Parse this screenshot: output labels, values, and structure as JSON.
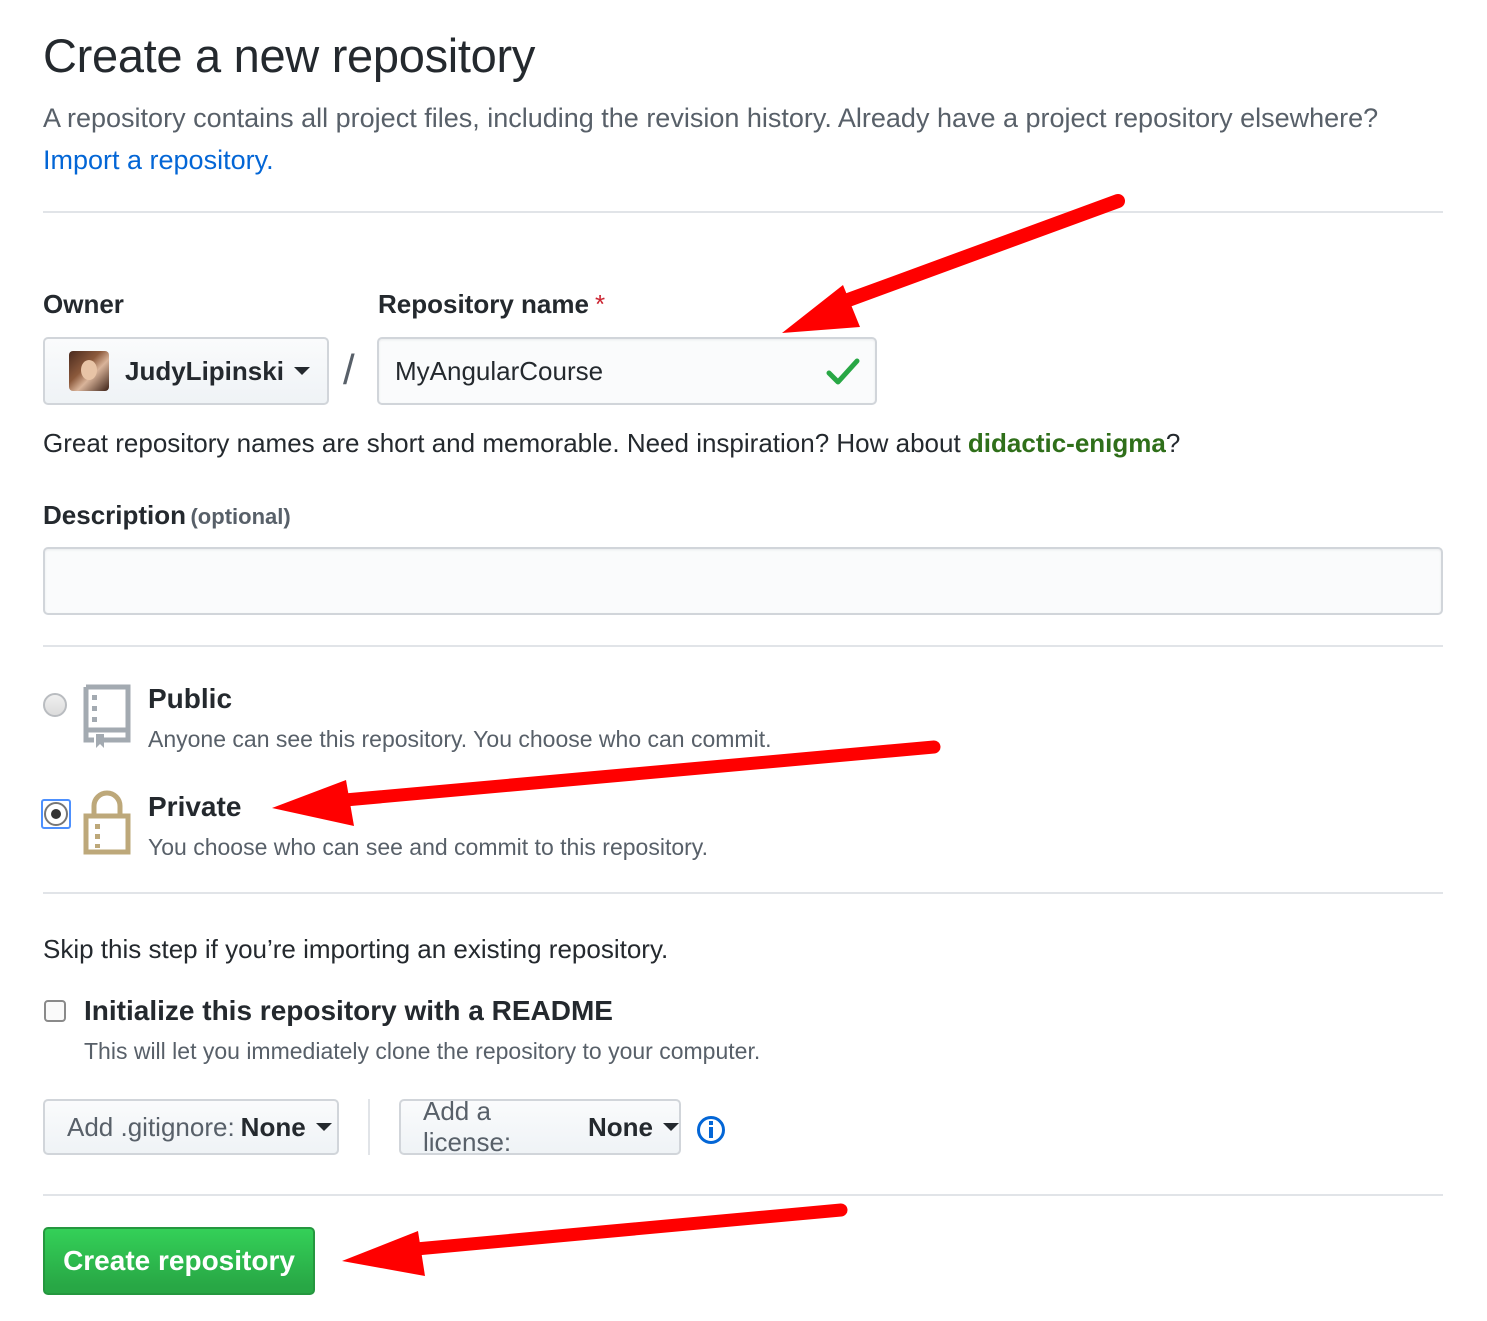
{
  "header": {
    "title": "Create a new repository",
    "subtitle": "A repository contains all project files, including the revision history. Already have a project repository elsewhere?",
    "import_link": "Import a repository."
  },
  "owner": {
    "label": "Owner",
    "value": "JudyLipinski",
    "separator": "/"
  },
  "repo_name": {
    "label": "Repository name",
    "required_mark": "*",
    "value": "MyAngularCourse",
    "valid": true
  },
  "name_hint": {
    "prefix": "Great repository names are short and memorable. Need inspiration? How about ",
    "suggestion": "didactic-enigma",
    "suffix": "?"
  },
  "description": {
    "label": "Description",
    "optional": "(optional)",
    "value": ""
  },
  "visibility": {
    "selected": "private",
    "options": [
      {
        "id": "public",
        "title": "Public",
        "desc": "Anyone can see this repository. You choose who can commit.",
        "icon": "repo-book-icon"
      },
      {
        "id": "private",
        "title": "Private",
        "desc": "You choose who can see and commit to this repository.",
        "icon": "lock-icon"
      }
    ]
  },
  "init": {
    "skip_note": "Skip this step if you’re importing an existing repository.",
    "readme_label": "Initialize this repository with a README",
    "readme_desc": "This will let you immediately clone the repository to your computer.",
    "readme_checked": false
  },
  "gitignore": {
    "prefix": "Add .gitignore: ",
    "value": "None"
  },
  "license": {
    "prefix": "Add a license: ",
    "value": "None"
  },
  "submit": {
    "label": "Create repository"
  },
  "colors": {
    "link": "#0366d6",
    "primary_button": "#28a745",
    "annotation_arrow": "#ff0000",
    "valid_check": "#28a745",
    "required": "#cb2431"
  }
}
